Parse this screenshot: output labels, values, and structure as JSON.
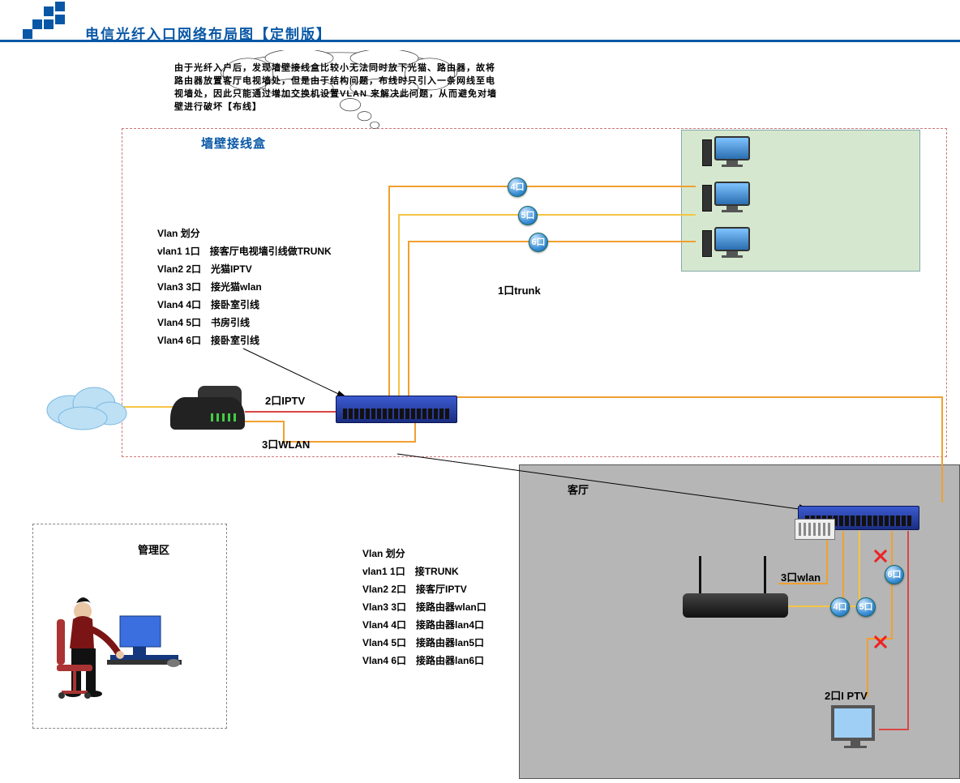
{
  "header": {
    "title": "电信光纤入口网络布局图【定制版】"
  },
  "thought": {
    "text": "由于光纤入户后，发现墙壁接线盒比较小无法同时放下光猫、路由器，故将路由器放置客厅电视墙处，但是由于结构问题，布线时只引入一条网线至电视墙处，因此只能通过增加交换机设置VLAN 来解决此问题，从而避免对墙壁进行破坏【布线】"
  },
  "labels": {
    "wall_box": "墙壁接线盒",
    "port1": "1口trunk",
    "iptv2": "2口IPTV",
    "wlan3": "3口WLAN",
    "port4": "4口",
    "port5": "5口",
    "port6": "6口",
    "admin": "管理区",
    "living": "客厅",
    "living_wlan3": "3口wlan",
    "living_iptv2": "2口I PTV",
    "p4b": "4口",
    "p5b": "5口",
    "p6b": "6口"
  },
  "vlan_upper": {
    "heading": "Vlan 划分",
    "rows": [
      "vlan1 1口　接客厅电视墙引线做TRUNK",
      "Vlan2 2口　光猫IPTV",
      "Vlan3 3口　接光猫wlan",
      "Vlan4 4口　接卧室引线",
      "Vlan4 5口　书房引线",
      "Vlan4 6口　接卧室引线"
    ]
  },
  "vlan_lower": {
    "heading": "Vlan 划分",
    "rows": [
      "vlan1 1口　接TRUNK",
      "Vlan2 2口　接客厅IPTV",
      "Vlan3 3口　接路由器wlan口",
      "Vlan4 4口　接路由器lan4口",
      "Vlan4 5口　接路由器lan5口",
      "Vlan4 6口　接路由器lan6口"
    ]
  },
  "devices": {
    "modem_name": "光猫",
    "switch1": "交换机(墙壁)",
    "switch2": "交换机(客厅)",
    "router": "无线路由器",
    "pc_room1": "PC-卧室",
    "pc_room2": "PC-书房",
    "pc_room3": "PC-卧室2",
    "tv": "IPTV电视",
    "admin_pc": "管理PC",
    "internet": "Internet"
  }
}
